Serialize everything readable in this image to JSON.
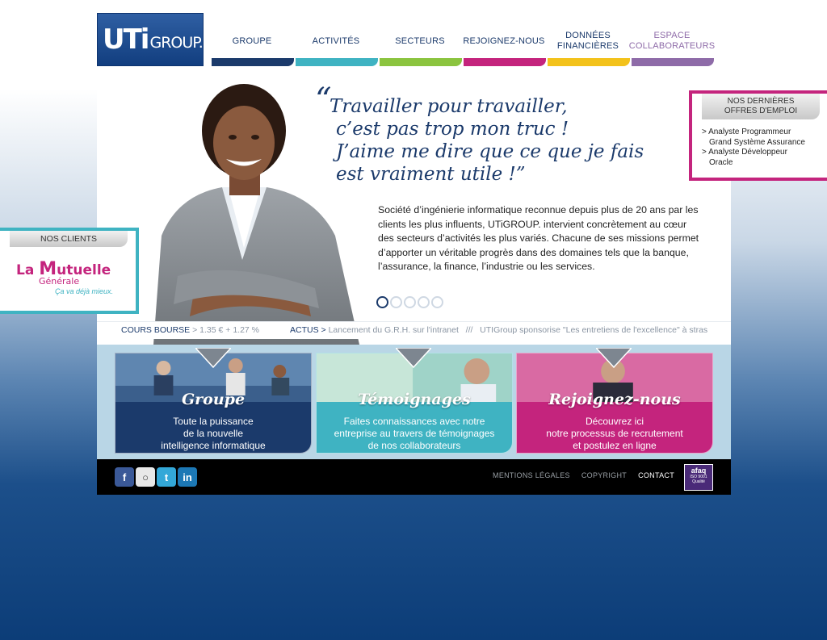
{
  "logo": {
    "uti": "UTi",
    "group": "GROUP."
  },
  "nav": [
    {
      "label": "GROUPE",
      "color": "#1b3a6b"
    },
    {
      "label": "ACTIVITÉS",
      "color": "#3fb3c2"
    },
    {
      "label": "SECTEURS",
      "color": "#8bc43f"
    },
    {
      "label": "REJOIGNEZ-NOUS",
      "color": "#c4247d"
    },
    {
      "label": "DONNÉES FINANCIÈRES",
      "color": "#f3c21b"
    },
    {
      "label": "ESPACE COLLABORATEURS",
      "color": "#8e6ba8"
    }
  ],
  "hero": {
    "quote_open": "“",
    "quote_lines": [
      "Travailler pour travailler,",
      "c’est pas trop mon truc !",
      "J’aime me dire que ce que je fais",
      "est vraiment utile !”"
    ],
    "text": "Société d’ingénierie informatique reconnue depuis plus de 20 ans par les clients les plus influents, UTiGROUP. intervient concrètement au cœur des secteurs d’activités les plus variés. Chacune de ses missions permet d’apporter un véritable progrès dans des domaines tels que la banque, l’assurance, la finance, l’industrie ou les services."
  },
  "ticker": {
    "bourse_label": "COURS BOURSE",
    "bourse_value": "1.35 € + 1.27 %",
    "actus_label": "ACTUS",
    "actus_items": "Lancement du G.R.H. sur l'intranet   ///   UTIGroup sponsorise \"Les entretiens de l'excellence\" à stras"
  },
  "cards": [
    {
      "title": "Groupe",
      "text": "Toute la puissance\nde la nouvelle\nintelligence informatique",
      "color": "#1b3a6b"
    },
    {
      "title": "Témoignages",
      "text": "Faites connaissances avec notre\nentreprise au travers de témoignages\nde nos collaborateurs",
      "color": "#3fb3c2"
    },
    {
      "title": "Rejoignez-nous",
      "text": "Découvrez ici\nnotre processus de recrutement\net postulez en ligne",
      "color": "#c4247d"
    }
  ],
  "footer": {
    "social": [
      {
        "icon": "facebook-icon",
        "glyph": "f",
        "color": "#3b5998"
      },
      {
        "icon": "blog-icon",
        "glyph": "○",
        "color": "#e8e8e8"
      },
      {
        "icon": "twitter-icon",
        "glyph": "t",
        "color": "#33a8d8"
      },
      {
        "icon": "linkedin-icon",
        "glyph": "in",
        "color": "#1c78b5"
      }
    ],
    "links": [
      "MENTIONS LÉGALES",
      "COPYRIGHT",
      "CONTACT"
    ],
    "afaq_title": "afaq",
    "afaq_iso": "ISO 9001",
    "afaq_qualite": "Qualité"
  },
  "clients": {
    "tab": "NOS CLIENTS",
    "logo_la": "La",
    "logo_m": "M",
    "logo_rest": "utuelle",
    "logo_sub": "Générale",
    "logo_tag": "Ça va déjà mieux."
  },
  "offres": {
    "tab_line1": "NOS DERNIÈRES",
    "tab_line2": "OFFRES D'EMPLOI",
    "items": [
      {
        "line1": "> Analyste Programmeur",
        "line2": "Grand Système Assurance"
      },
      {
        "line1": "> Analyste Développeur",
        "line2": "Oracle"
      }
    ]
  }
}
